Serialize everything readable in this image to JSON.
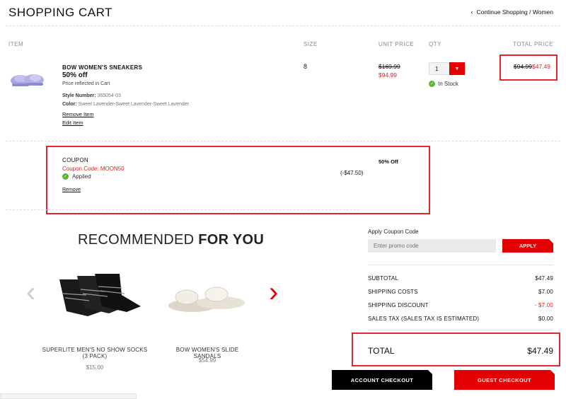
{
  "header": {
    "title": "SHOPPING CART",
    "continue_label": "Continue Shopping / Women"
  },
  "columns": {
    "item": "ITEM",
    "size": "SIZE",
    "unit_price": "UNIT PRICE",
    "qty": "QTY",
    "total_price": "TOTAL PRICE"
  },
  "cart_item": {
    "name": "BOW WOMEN'S SNEAKERS",
    "discount": "50% off",
    "price_note": "Price reflected in Cart",
    "style_label": "Style Number:",
    "style_value": "365054-03",
    "color_label": "Color:",
    "color_value": "Sweet Lavender-Sweet Lavender-Sweet Lavender",
    "remove_label": "Remove Item",
    "edit_label": "Edit Item",
    "size": "8",
    "unit_price_original": "$169.99",
    "unit_price_sale": "$94.99",
    "qty": "1",
    "stock": "In Stock",
    "total_original": "$94.99",
    "total_sale": "$47.49"
  },
  "coupon": {
    "heading": "COUPON",
    "code_text": "Coupon Code: MOON50",
    "status": "Applied",
    "remove_label": "Remove",
    "amount": "(-$47.50)",
    "description": "50% Off"
  },
  "recommended": {
    "title_light": "RECOMMENDED",
    "title_bold": "FOR YOU",
    "items": [
      {
        "name": "SUPERLITE MEN'S NO SHOW SOCKS (3 PACK)",
        "price": "$15.00"
      },
      {
        "name": "BOW WOMEN'S SLIDE SANDALS",
        "price": "$54.99"
      }
    ]
  },
  "promo": {
    "label": "Apply Coupon Code",
    "placeholder": "Enter promo code",
    "apply_label": "APPLY"
  },
  "summary": {
    "subtotal_label": "SUBTOTAL",
    "subtotal_value": "$47.49",
    "shipping_label": "SHIPPING COSTS",
    "shipping_value": "$7.00",
    "shipping_discount_label": "SHIPPING DISCOUNT",
    "shipping_discount_value": "- $7.00",
    "tax_label": "SALES TAX (SALES TAX IS ESTIMATED)",
    "tax_value": "$0.00",
    "total_label": "TOTAL",
    "total_value": "$47.49"
  },
  "checkout": {
    "account_label": "ACCOUNT CHECKOUT",
    "guest_label": "GUEST CHECKOUT"
  },
  "colors": {
    "accent_red": "#e40000",
    "highlight_border": "#e4262a",
    "in_stock_green": "#5db435"
  }
}
